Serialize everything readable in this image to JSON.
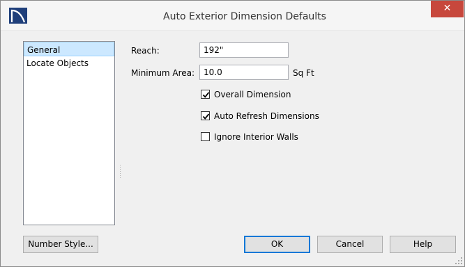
{
  "window": {
    "title": "Auto Exterior Dimension Defaults",
    "close_glyph": "✕"
  },
  "sidebar": {
    "items": [
      {
        "label": "General",
        "selected": true
      },
      {
        "label": "Locate Objects",
        "selected": false
      }
    ]
  },
  "form": {
    "reach_label": "Reach:",
    "reach_value": "192\"",
    "min_area_label": "Minimum Area:",
    "min_area_value": "10.0",
    "min_area_unit": "Sq Ft",
    "checkboxes": [
      {
        "label": "Overall Dimension",
        "checked": true
      },
      {
        "label": "Auto Refresh Dimensions",
        "checked": true
      },
      {
        "label": "Ignore Interior Walls",
        "checked": false
      }
    ]
  },
  "buttons": {
    "number_style": "Number Style...",
    "ok": "OK",
    "cancel": "Cancel",
    "help": "Help"
  },
  "colors": {
    "close_bg": "#c7473c",
    "selection_bg": "#cce8ff",
    "default_button_border": "#0078d7",
    "app_icon_bg": "#1f3f7a"
  }
}
